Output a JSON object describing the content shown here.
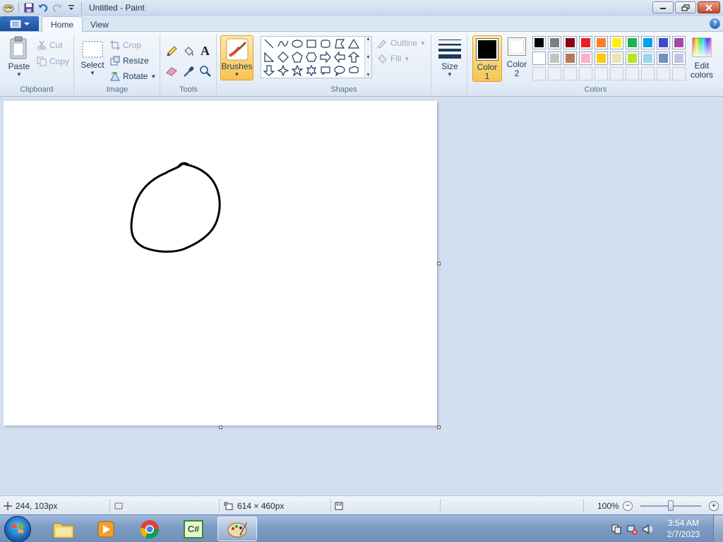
{
  "window": {
    "title": "Untitled - Paint"
  },
  "tabs": [
    {
      "label": "Home",
      "active": true
    },
    {
      "label": "View",
      "active": false
    }
  ],
  "clipboard": {
    "paste": "Paste",
    "cut": "Cut",
    "copy": "Copy",
    "label": "Clipboard"
  },
  "image": {
    "select": "Select",
    "crop": "Crop",
    "resize": "Resize",
    "rotate": "Rotate",
    "label": "Image"
  },
  "tools": {
    "label": "Tools",
    "text_glyph": "A"
  },
  "brushes": {
    "label": "Brushes"
  },
  "shapes": {
    "outline": "Outline",
    "fill": "Fill",
    "label": "Shapes"
  },
  "size": {
    "label": "Size"
  },
  "colors": {
    "color1_line1": "Color",
    "color1_line2": "1",
    "color2_line1": "Color",
    "color2_line2": "2",
    "edit_line1": "Edit",
    "edit_line2": "colors",
    "label": "Colors",
    "color1_value": "#000000",
    "color2_value": "#ffffff",
    "palette_row1": [
      "#000000",
      "#7f7f7f",
      "#880015",
      "#ed1c24",
      "#ff7f27",
      "#fff200",
      "#22b14c",
      "#00a2e8",
      "#3f48cc",
      "#a349a4"
    ],
    "palette_row2": [
      "#ffffff",
      "#c3c3c3",
      "#b97a57",
      "#ffaec9",
      "#ffc90e",
      "#efe4b0",
      "#b5e61d",
      "#99d9ea",
      "#7092be",
      "#c8bfe7"
    ]
  },
  "status": {
    "cursor_pos": "244, 103px",
    "canvas_size": "614 × 460px",
    "zoom": "100%"
  },
  "taskbar": {
    "time": "3:54 AM",
    "date": "2/7/2023",
    "csharp_label": "C#"
  }
}
